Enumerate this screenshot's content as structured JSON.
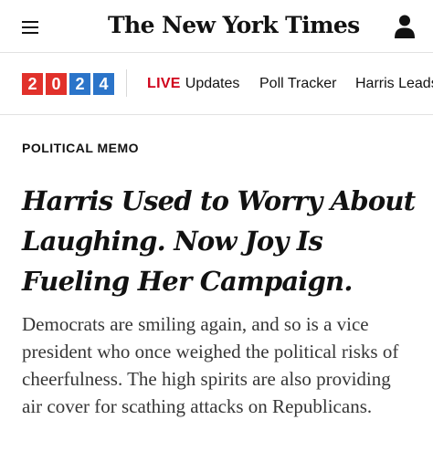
{
  "header": {
    "masthead": "The New York Times",
    "menu_icon": "hamburger-menu-icon",
    "account_icon": "account-person-icon"
  },
  "nav": {
    "badge_year": [
      "2",
      "0",
      "2",
      "4"
    ],
    "badge_colors": [
      "#e1312b",
      "#2b74c9"
    ],
    "live_tag": "LIVE",
    "live_label": "Updates",
    "items": [
      "Poll Tracker",
      "Harris Leads"
    ],
    "live_color": "#d0021b"
  },
  "article": {
    "kicker": "POLITICAL MEMO",
    "headline": "Harris Used to Worry About Laughing. Now Joy Is Fueling Her Campaign.",
    "summary": "Democrats are smiling again, and so is a vice president who once weighed the political risks of cheerfulness. The high spirits are also providing air cover for scathing attacks on Republicans."
  }
}
